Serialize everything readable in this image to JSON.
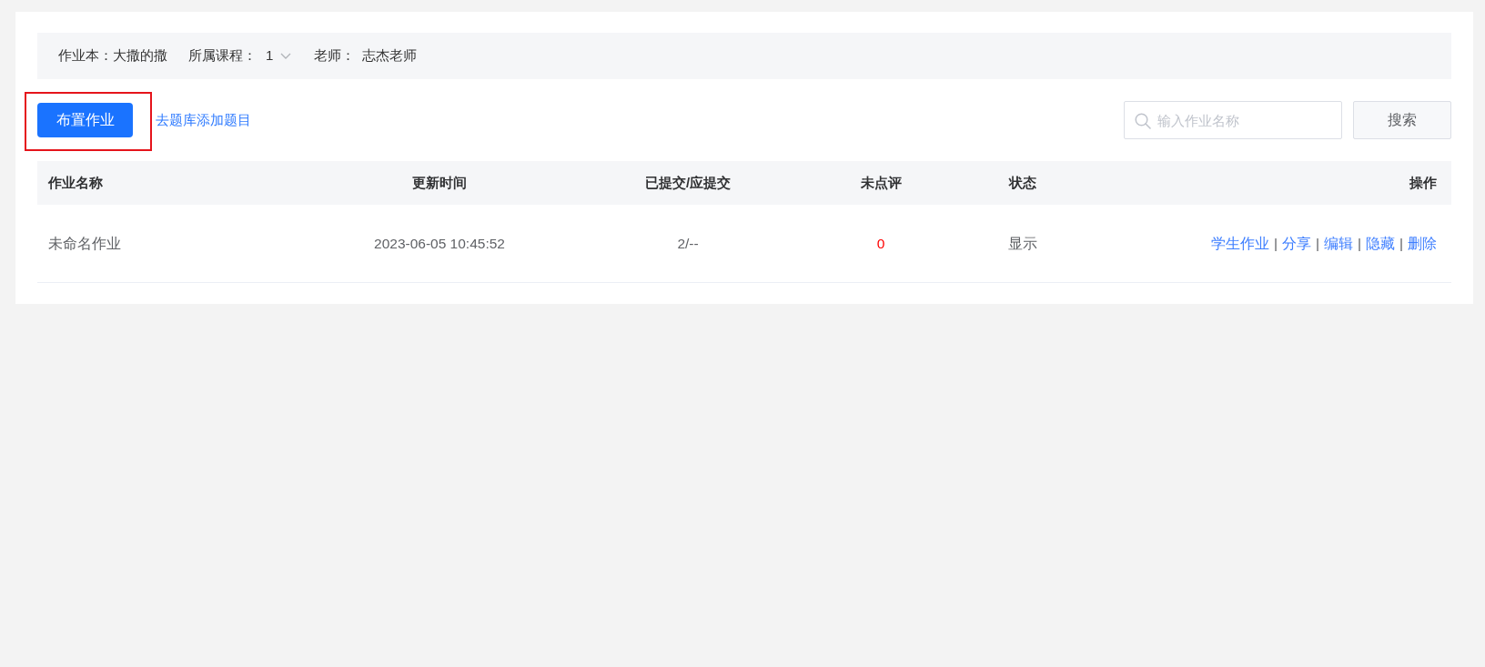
{
  "filter_bar": {
    "items": [
      {
        "kind": "inline",
        "label": "作业本：",
        "value": "大撒的撒"
      },
      {
        "kind": "select",
        "label": "所属课程：",
        "value": "1"
      },
      {
        "kind": "field",
        "label": "老师：",
        "value": "志杰老师"
      }
    ]
  },
  "toolbar": {
    "assign_button": {
      "label": "布置作业",
      "highlighted": true
    },
    "add_questions_link": "去题库添加题目",
    "search": {
      "placeholder": "输入作业名称"
    },
    "search_button": "搜索"
  },
  "table": {
    "columns": [
      "作业名称",
      "更新时间",
      "已提交/应提交",
      "未点评",
      "状态",
      "操作"
    ],
    "rows": [
      {
        "cells": [
          "未命名作业",
          "2023-06-05 10:45:52",
          "2/--",
          "0",
          "显示"
        ],
        "actions": [
          "学生作业",
          "分享",
          "编辑",
          "隐藏",
          "删除"
        ],
        "action_separator": "|"
      }
    ]
  }
}
